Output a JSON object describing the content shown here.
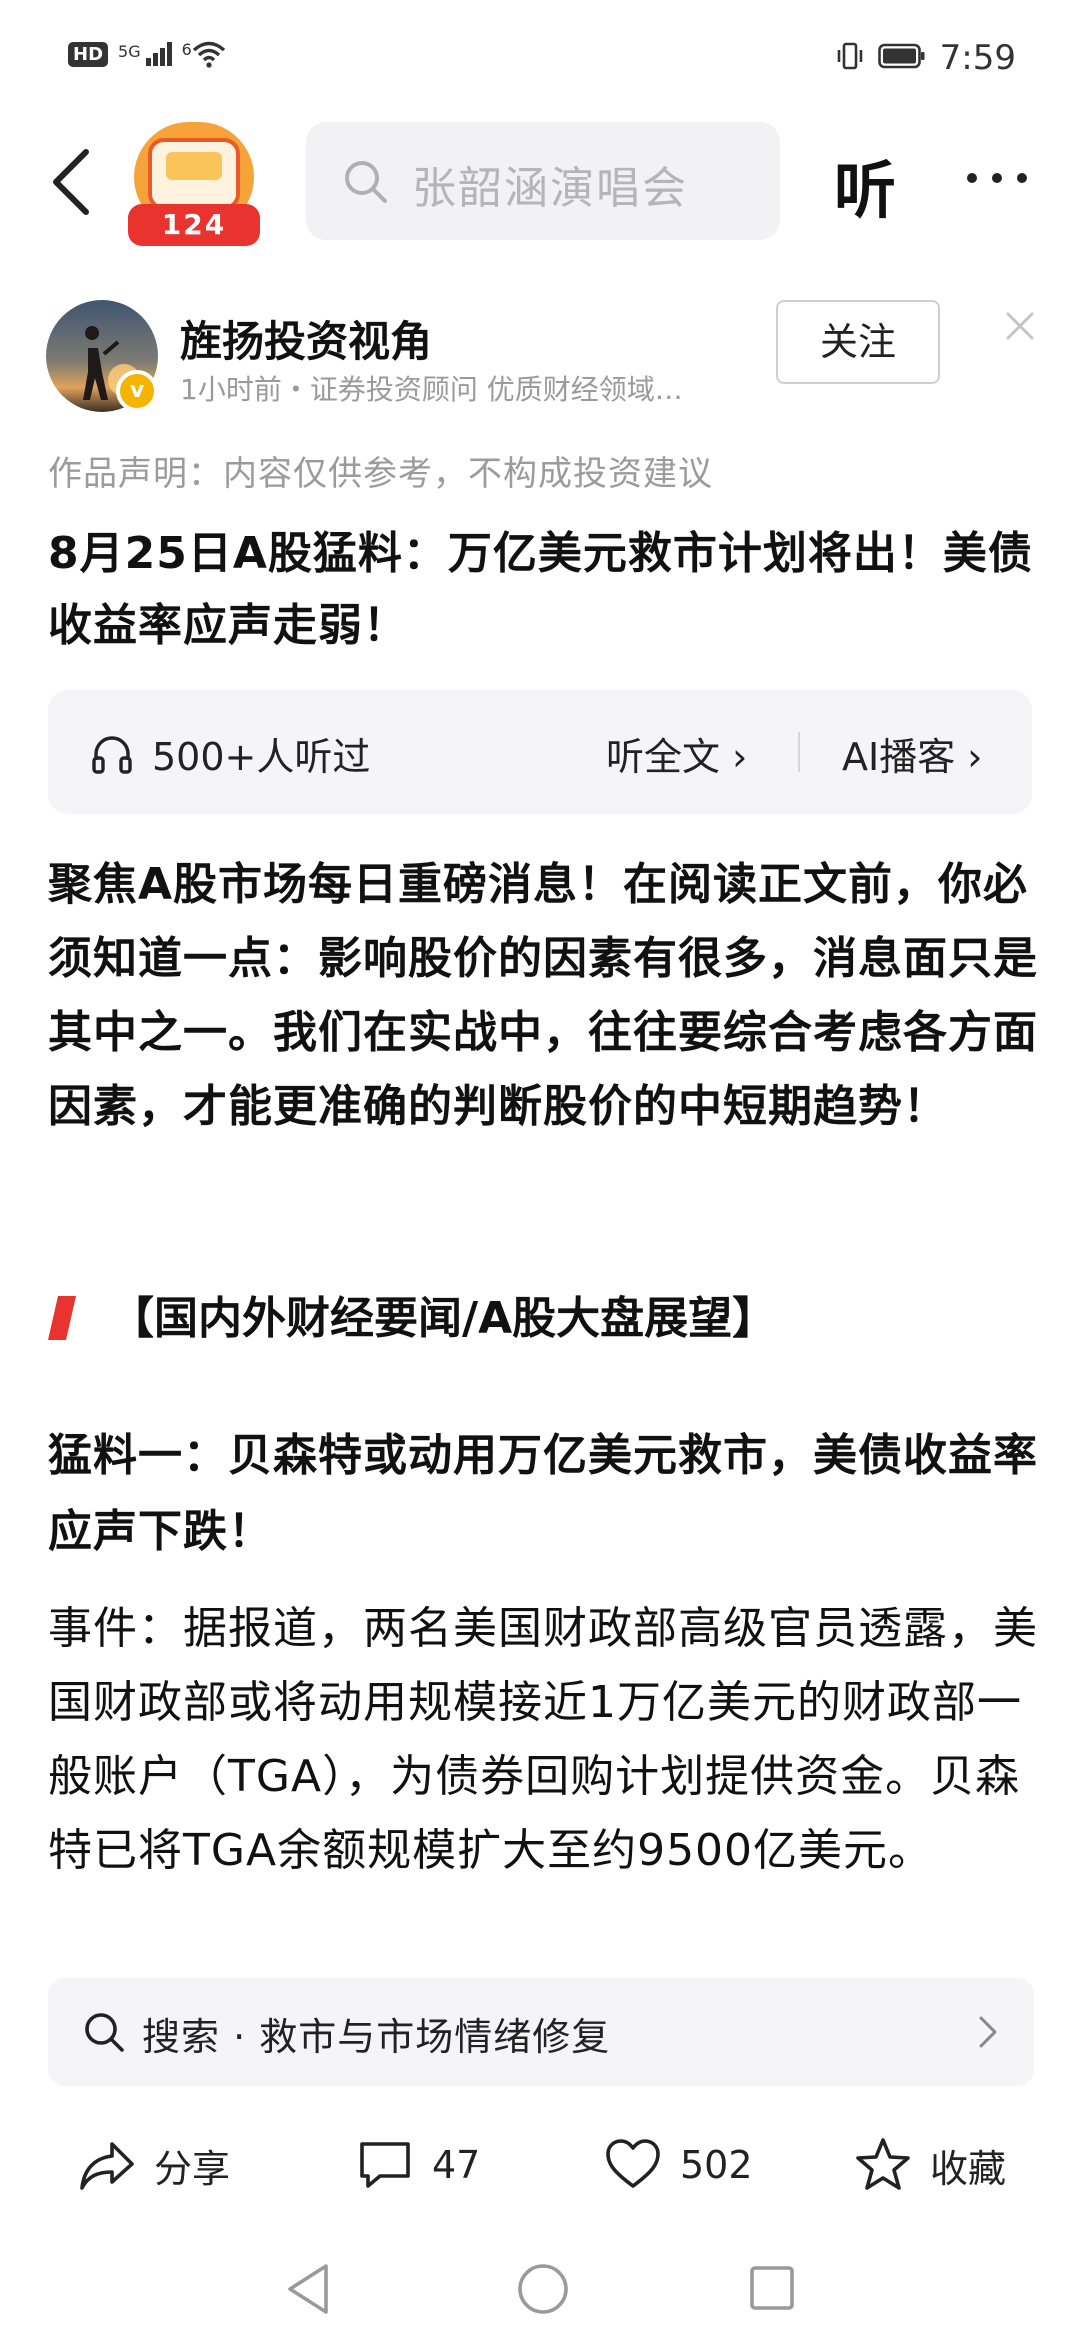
{
  "status_bar": {
    "left_badge": "HD",
    "network_1": "5G",
    "network_2": "6",
    "time": "7:59"
  },
  "top_nav": {
    "promo_tag": "124",
    "search_placeholder": "张韶涵演唱会",
    "listen_label": "听"
  },
  "author": {
    "name": "旌扬投资视角",
    "verified_mark": "v",
    "meta": "1小时前・证券投资顾问 优质财经领域…",
    "follow_label": "关注"
  },
  "disclaimer": "作品声明：内容仅供参考，不构成投资建议",
  "article": {
    "title": "8月25日A股猛料：万亿美元救市计划将出！美债收益率应声走弱！",
    "listen_card": {
      "count": "500+人听过",
      "listen_full": "听全文 ›",
      "ai_podcast": "AI播客 ›"
    },
    "intro": "聚焦A股市场每日重磅消息！在阅读正文前，你必须知道一点：影响股价的因素有很多，消息面只是其中之一。我们在实战中，往往要综合考虑各方面因素，才能更准确的判断股价的中短期趋势！",
    "section_header": "【国内外财经要闻/A股大盘展望】",
    "headline_1": "猛料一：贝森特或动用万亿美元救市，美债收益率应声下跌！",
    "event_text": "事件：据报道，两名美国财政部高级官员透露，美国财政部或将动用规模接近1万亿美元的财政部一般账户（TGA），为债券回购计划提供资金。贝森特已将TGA余额规模扩大至约9500亿美元。"
  },
  "related_search": {
    "text": "搜索 · 救市与市场情绪修复"
  },
  "actions": {
    "share": "分享",
    "comments": "47",
    "likes": "502",
    "favorite": "收藏"
  },
  "colors": {
    "accent_red": "#e8332f",
    "promo_orange": "#f6a43a",
    "verify_gold": "#f5b400",
    "muted_text": "#9b9b9b"
  }
}
